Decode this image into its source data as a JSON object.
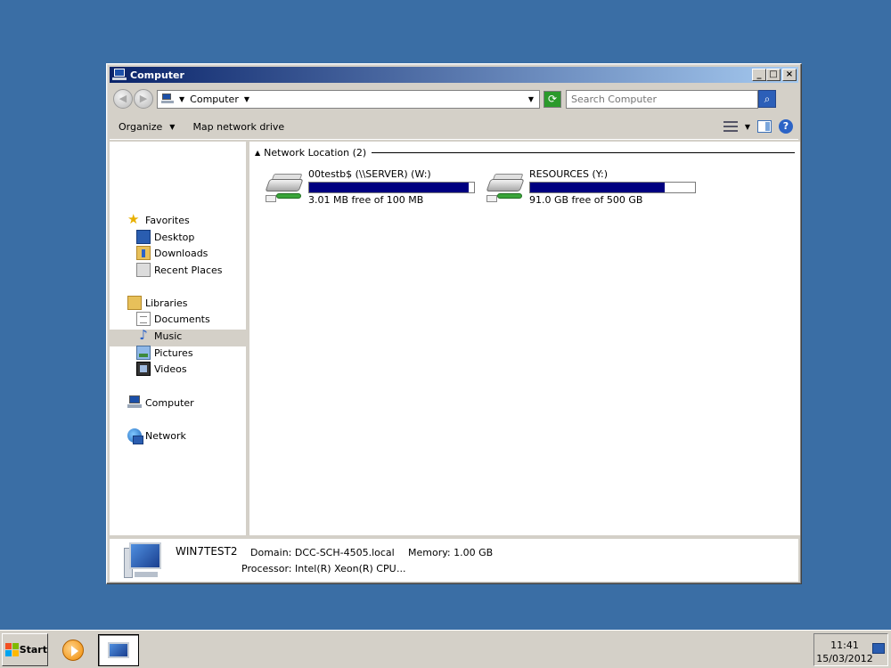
{
  "window": {
    "title": "Computer",
    "buttons": {
      "minimize": "_",
      "maximize": "□",
      "close": "×"
    }
  },
  "address": {
    "path": "Computer",
    "search_placeholder": "Search Computer"
  },
  "commands": {
    "organize": "Organize",
    "map_network_drive": "Map network drive"
  },
  "nav": {
    "favorites": "Favorites",
    "desktop": "Desktop",
    "downloads": "Downloads",
    "recent_places": "Recent Places",
    "libraries": "Libraries",
    "documents": "Documents",
    "music": "Music",
    "pictures": "Pictures",
    "videos": "Videos",
    "computer": "Computer",
    "network": "Network"
  },
  "content": {
    "group_header": "Network Location (2)",
    "drives": [
      {
        "name": "00testb$ (\\\\SERVER) (W:)",
        "free": "3.01 MB free of 100 MB",
        "used_fraction": 0.97
      },
      {
        "name": "RESOURCES (Y:)",
        "free": "91.0 GB free of 500 GB",
        "used_fraction": 0.818
      }
    ]
  },
  "details": {
    "computer_name": "WIN7TEST2",
    "domain": "Domain: DCC-SCH-4505.local",
    "memory": "Memory: 1.00 GB",
    "processor": "Processor: Intel(R) Xeon(R) CPU",
    "ellipsis": "..."
  },
  "taskbar": {
    "start_label": "Start",
    "time": "11:41",
    "date": "15/03/2012"
  },
  "colors": {
    "desktop": "#3a6ea5",
    "titlebar_start": "#0a246a",
    "drive_fill": "#000080"
  }
}
